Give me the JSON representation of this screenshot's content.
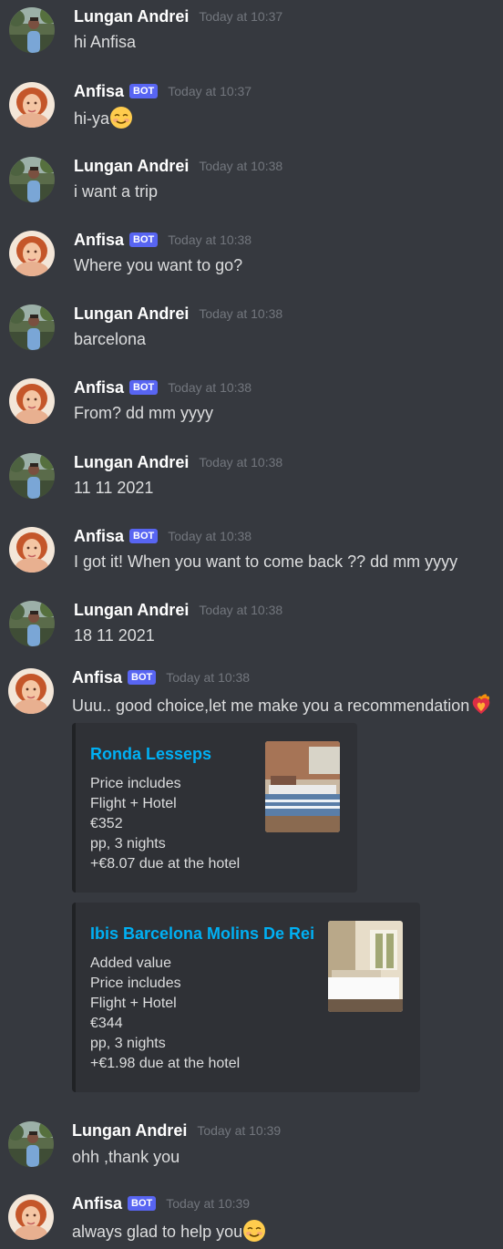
{
  "users": {
    "andrei": "Lungan Andrei",
    "anfisa": "Anfisa",
    "bot_tag": "BOT"
  },
  "messages": [
    {
      "author": "Lungan Andrei",
      "time": "Today at 10:37",
      "text": "hi Anfisa"
    },
    {
      "author": "Anfisa",
      "time": "Today at 10:37",
      "text": "hi-ya",
      "emoji": "smiling-face-emoji"
    },
    {
      "author": "Lungan Andrei",
      "time": "Today at 10:38",
      "text": "i want a trip"
    },
    {
      "author": "Anfisa",
      "time": "Today at 10:38",
      "text": "Where you want to go?"
    },
    {
      "author": "Lungan Andrei",
      "time": "Today at 10:38",
      "text": "barcelona"
    },
    {
      "author": "Anfisa",
      "time": "Today at 10:38",
      "text": "From? dd mm yyyy"
    },
    {
      "author": "Lungan Andrei",
      "time": "Today at 10:38",
      "text": "11 11 2021"
    },
    {
      "author": "Anfisa",
      "time": "Today at 10:38",
      "text": "I got it! When you want to come back ?? dd mm yyyy"
    },
    {
      "author": "Lungan Andrei",
      "time": "Today at 10:38",
      "text": "18 11 2021"
    },
    {
      "author": "Anfisa",
      "time": "Today at 10:38",
      "text": "Uuu.. good choice,let me make you a recommendation",
      "emoji": "fire-heart-emoji"
    },
    {
      "author": "Lungan Andrei",
      "time": "Today at 10:39",
      "text": "ohh ,thank you"
    },
    {
      "author": "Anfisa",
      "time": "Today at 10:39",
      "text": "always glad to help you",
      "emoji": "smiling-face-emoji"
    }
  ],
  "embeds": [
    {
      "title": "Ronda Lesseps",
      "lines": [
        "Price includes",
        "Flight + Hotel",
        "€352",
        "pp, 3 nights",
        "+€8.07 due at the hotel"
      ],
      "thumbnail": "hotel-room-thumbnail"
    },
    {
      "title": "Ibis Barcelona Molins De Rei",
      "lines": [
        "Added value",
        "Price includes",
        "Flight + Hotel",
        "€344",
        "pp, 3 nights",
        "+€1.98 due at the hotel"
      ],
      "thumbnail": "hotel-room-thumbnail"
    }
  ],
  "colors": {
    "background": "#36393f",
    "embed_background": "#2f3136",
    "link": "#00b0f4",
    "bot_badge": "#5865f2",
    "timestamp": "#72767d"
  }
}
